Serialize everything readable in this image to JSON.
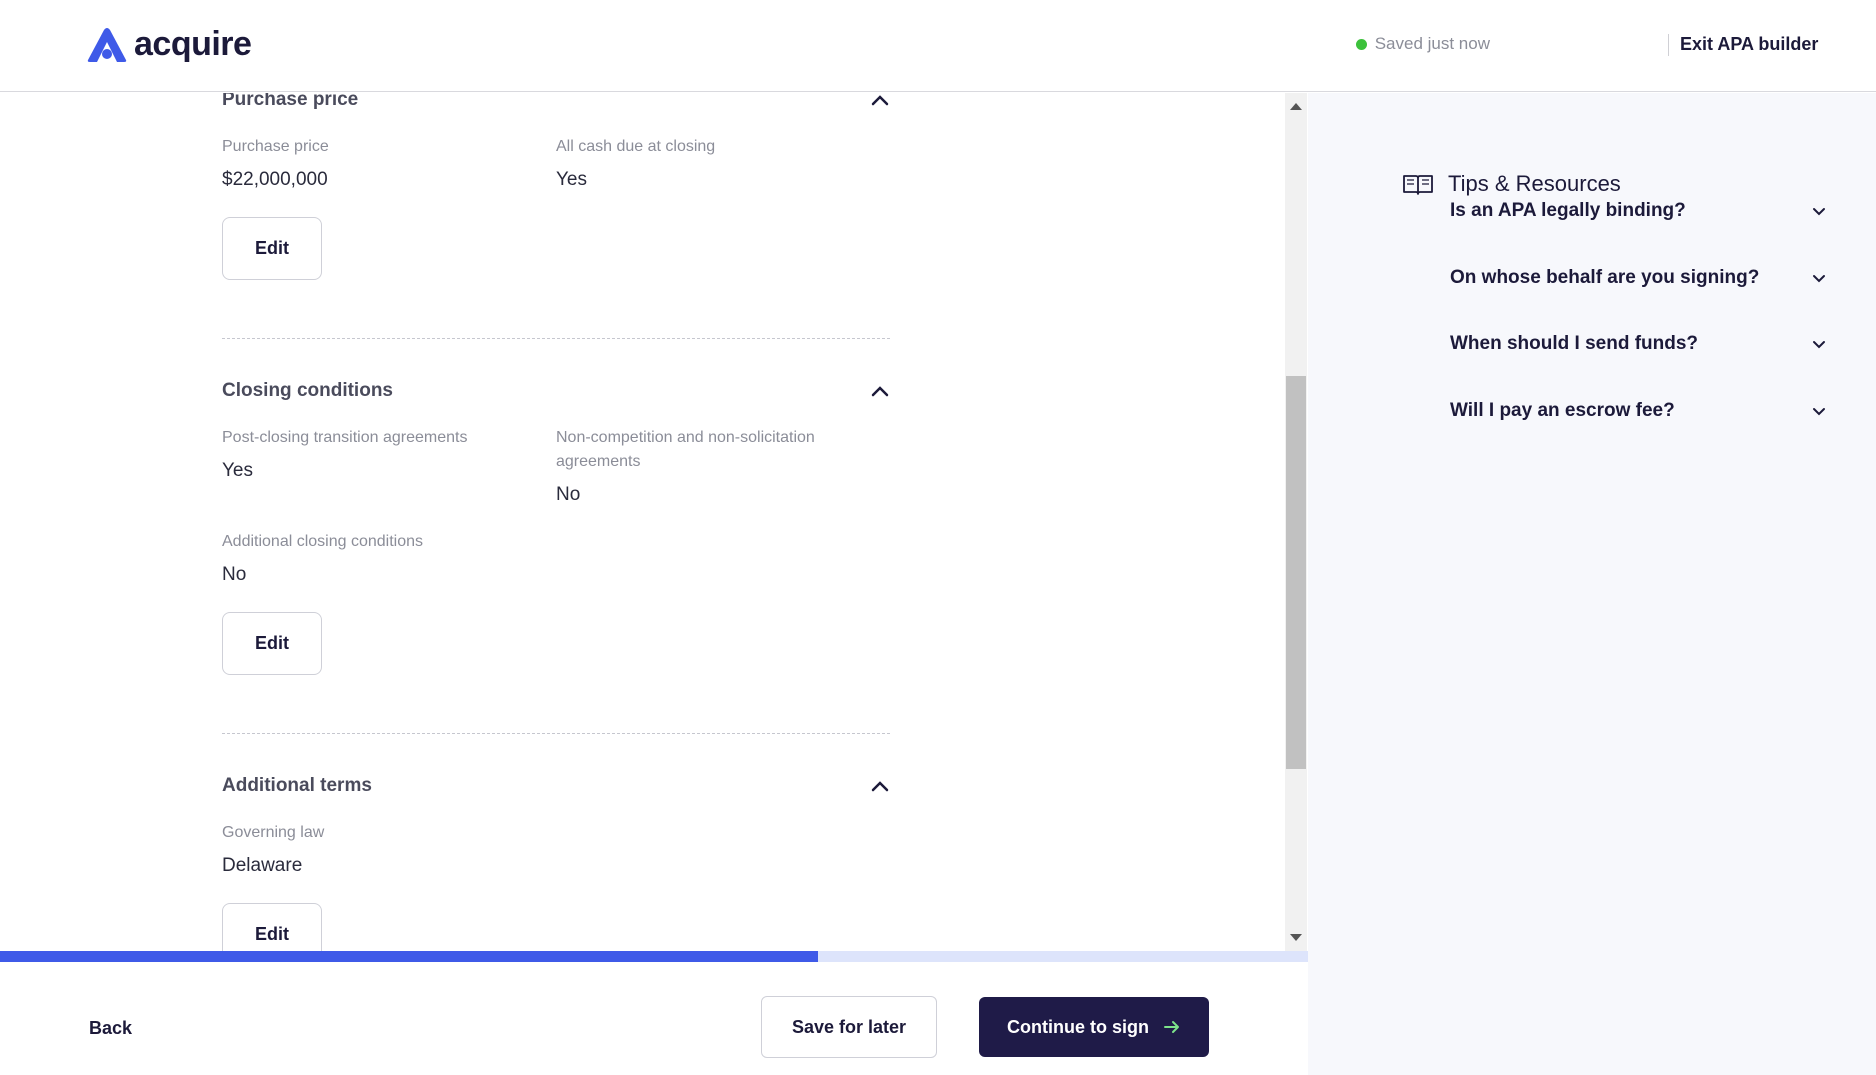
{
  "header": {
    "logo_text": "acquire",
    "save_status": "Saved just now",
    "exit_label": "Exit APA builder"
  },
  "sections": {
    "purchase_price": {
      "title": "Purchase price",
      "fields": [
        {
          "label": "Purchase price",
          "value": "$22,000,000"
        },
        {
          "label": "All cash due at closing",
          "value": "Yes"
        }
      ],
      "edit_label": "Edit"
    },
    "closing_conditions": {
      "title": "Closing conditions",
      "fields": [
        {
          "label": "Post-closing transition agreements",
          "value": "Yes"
        },
        {
          "label_line1": "Non-competition and non-solicitation",
          "label_line2": "agreements",
          "value": "No"
        },
        {
          "label": "Additional closing conditions",
          "value": "No"
        }
      ],
      "edit_label": "Edit"
    },
    "additional_terms": {
      "title": "Additional terms",
      "fields": [
        {
          "label": "Governing law",
          "value": "Delaware"
        }
      ],
      "edit_label": "Edit"
    }
  },
  "progress": {
    "fraction": 0.625
  },
  "footer": {
    "back_label": "Back",
    "save_later_label": "Save for later",
    "continue_label": "Continue to sign"
  },
  "sidebar": {
    "title": "Tips & Resources",
    "faqs": [
      {
        "label": "Is an APA legally binding?"
      },
      {
        "label": "On whose behalf are you signing?"
      },
      {
        "label": "When should I send funds?"
      },
      {
        "label": "Will I pay an escrow fee?"
      }
    ]
  },
  "colors": {
    "brand": "#3f5ae8",
    "dark": "#1f1b48",
    "status_ok": "#3cc13b",
    "continue_arrow": "#7de38a"
  }
}
